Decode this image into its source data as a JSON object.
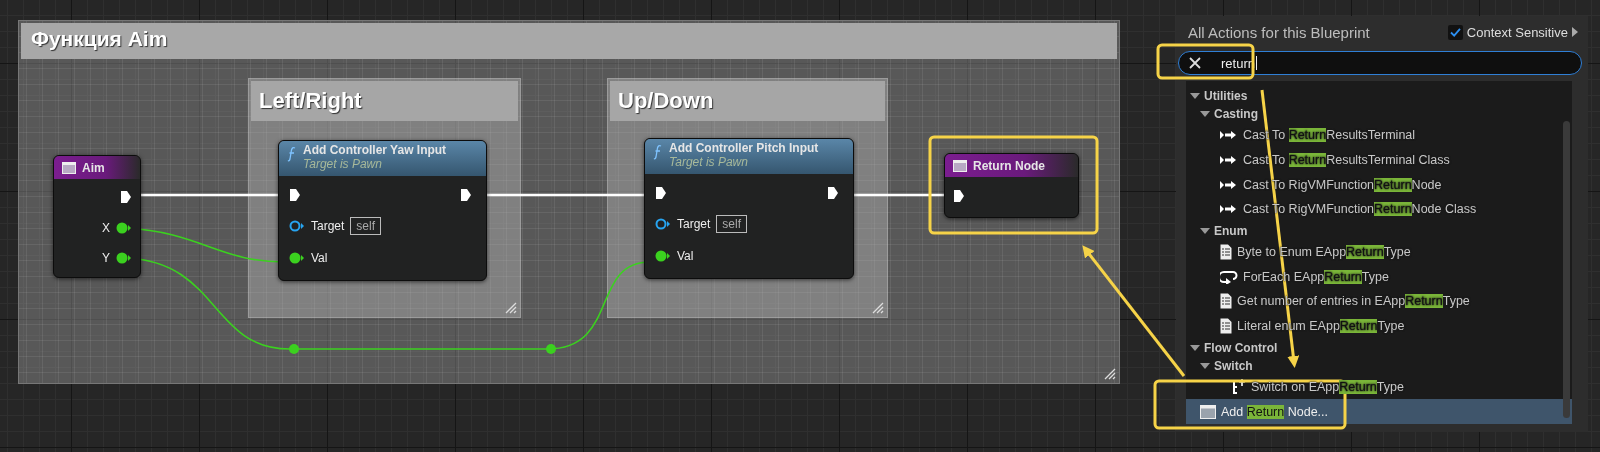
{
  "graph": {
    "comment": {
      "title": "Функция Aim"
    },
    "groups": [
      {
        "title": "Left/Right"
      },
      {
        "title": "Up/Down"
      }
    ],
    "nodes": [
      {
        "kind": "event",
        "title": "Aim",
        "outputs": [
          {
            "label": "X"
          },
          {
            "label": "Y"
          }
        ]
      },
      {
        "kind": "function",
        "title": "Add Controller Yaw Input",
        "subtitle": "Target is Pawn",
        "target": {
          "label": "Target",
          "value": "self"
        },
        "input": "Val"
      },
      {
        "kind": "function",
        "title": "Add Controller Pitch Input",
        "subtitle": "Target is Pawn",
        "target": {
          "label": "Target",
          "value": "self"
        },
        "input": "Val"
      },
      {
        "kind": "return",
        "title": "Return Node"
      }
    ]
  },
  "action_menu": {
    "title": "All Actions for this Blueprint",
    "context_sensitive": {
      "label": "Context Sensitive",
      "checked": true
    },
    "search": {
      "value": "return"
    },
    "tree": [
      {
        "label": "Utilities",
        "expanded": true,
        "children": [
          {
            "label": "Casting",
            "expanded": true,
            "children": [
              {
                "kind": "cast",
                "before": "Cast To ",
                "match": "Return",
                "after": "ResultsTerminal",
                "selected": false
              },
              {
                "kind": "cast",
                "before": "Cast To ",
                "match": "Return",
                "after": "ResultsTerminal Class",
                "selected": false
              },
              {
                "kind": "cast",
                "before": "Cast To RigVMFunction",
                "match": "Return",
                "after": "Node",
                "selected": false
              },
              {
                "kind": "cast",
                "before": "Cast To RigVMFunction",
                "match": "Return",
                "after": "Node Class",
                "selected": false
              }
            ]
          },
          {
            "label": "Enum",
            "expanded": true,
            "children": [
              {
                "kind": "enum",
                "before": "Byte to Enum EApp",
                "match": "Return",
                "after": "Type",
                "selected": false
              },
              {
                "kind": "foreach",
                "before": "ForEach EApp",
                "match": "Return",
                "after": "Type",
                "selected": false
              },
              {
                "kind": "enum",
                "before": "Get number of entries in EApp",
                "match": "Return",
                "after": "Type",
                "selected": false
              },
              {
                "kind": "enum",
                "before": "Literal enum EApp",
                "match": "Return",
                "after": "Type",
                "selected": false
              }
            ]
          }
        ]
      },
      {
        "label": "Flow Control",
        "expanded": true,
        "children": [
          {
            "label": "Switch",
            "expanded": true,
            "children": [
              {
                "kind": "switch",
                "before": "Switch on EApp",
                "match": "Return",
                "after": "Type",
                "selected": false
              }
            ]
          }
        ]
      },
      {
        "kind": "return",
        "before": "Add ",
        "match": "Return",
        "after": " Node...",
        "selected": true
      }
    ]
  }
}
